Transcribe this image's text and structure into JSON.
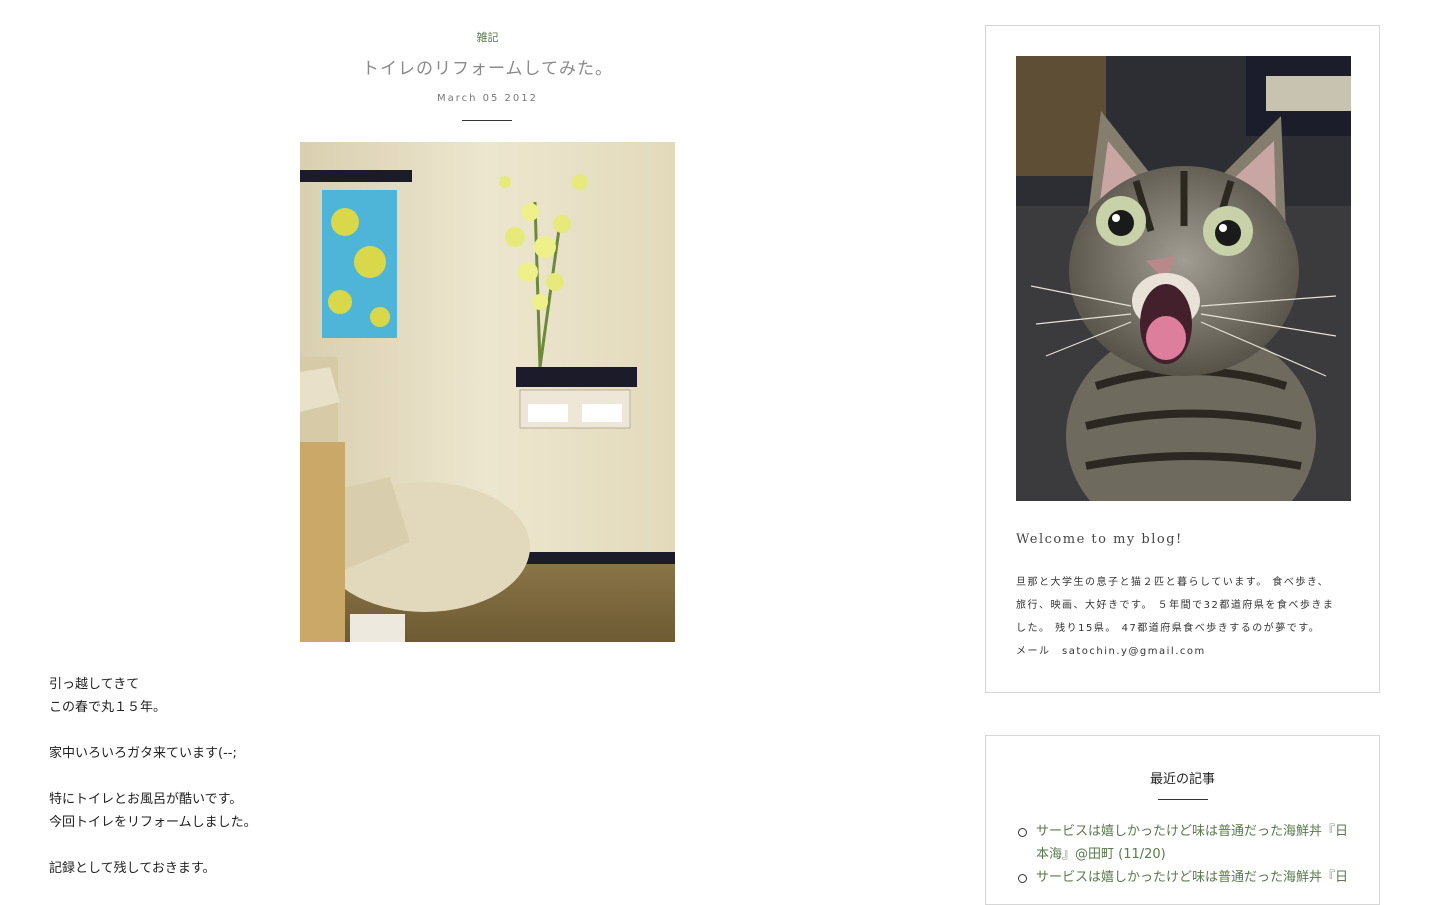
{
  "post": {
    "category": "雑記",
    "title": "トイレのリフォームしてみた。",
    "date": "March 05 2012",
    "body": [
      "引っ越してきて",
      "この春で丸１５年。",
      "",
      "家中いろいろガタ来ています(--;",
      "",
      "特にトイレとお風呂が酷いです。",
      "今回トイレをリフォームしました。",
      "",
      "記録として残しておきます。"
    ]
  },
  "sidebar": {
    "about": {
      "heading": "Welcome to my blog!",
      "text_lines": [
        "旦那と大学生の息子と猫２匹と暮らしています。 食べ歩き、",
        "旅行、映画、大好きです。 ５年間で32都道府県を食べ歩きま",
        "した。 残り15県。 47都道府県食べ歩きするのが夢です。",
        "メール　satochin.y@gmail.com"
      ]
    },
    "recent": {
      "heading": "最近の記事",
      "items": [
        {
          "line1": "サービスは嬉しかったけど味は普通だった海鮮丼『日",
          "line2": "本海』@田町 (11/20)"
        },
        {
          "line1": "サービスは嬉しかったけど味は普通だった海鮮丼『日",
          "line2": ""
        }
      ]
    }
  },
  "colors": {
    "link_green": "#5a7a4c",
    "title_gray": "#8a8a8a",
    "border": "#d6d6d6"
  }
}
